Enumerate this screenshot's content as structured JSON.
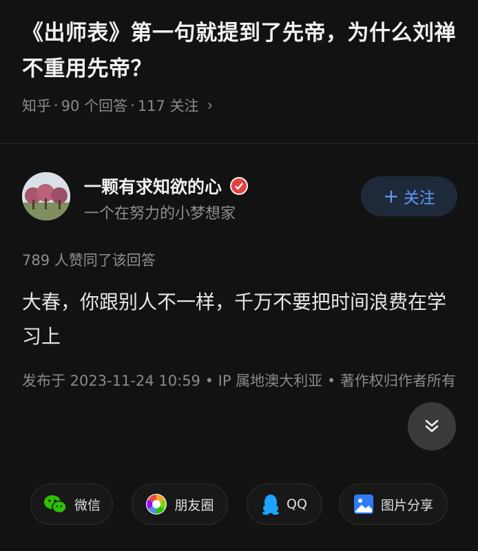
{
  "question": {
    "title": "《出师表》第一句就提到了先帝，为什么刘禅不重用先帝？",
    "source": "知乎",
    "answers": "90 个回答",
    "follows": "117 关注"
  },
  "author": {
    "name": "一颗有求知欲的心",
    "bio": "一个在努力的小梦想家",
    "follow_label": "关注"
  },
  "answer": {
    "votes": "789 人赞同了该回答",
    "content": "大春，你跟别人不一样，千万不要把时间浪费在学习上",
    "meta": "发布于 2023-11-24 10:59 • IP 属地澳大利亚 • 著作权归作者所有"
  },
  "share": {
    "wechat": "微信",
    "moments": "朋友圈",
    "qq": "QQ",
    "image": "图片分享"
  },
  "colors": {
    "background": "#121212",
    "accent": "#5c9cff",
    "badge": "#e2433f"
  }
}
